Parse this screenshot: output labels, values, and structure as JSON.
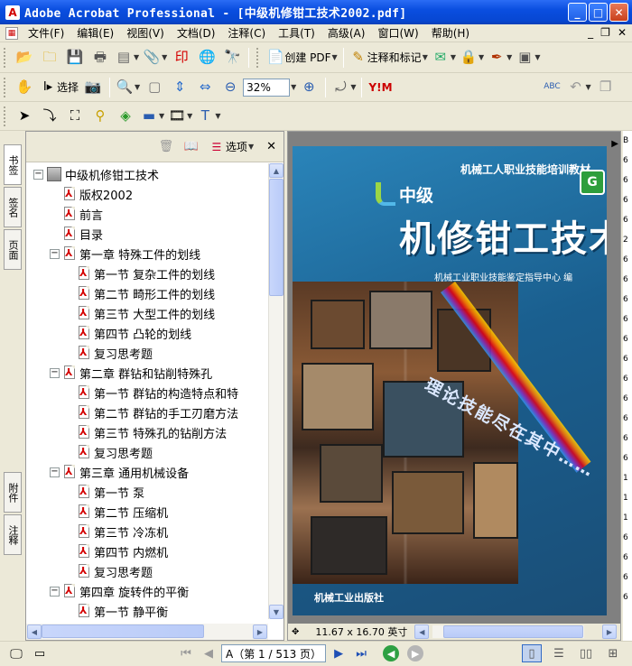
{
  "window": {
    "title": "Adobe Acrobat Professional - [中级机修钳工技术2002.pdf]",
    "app_icon": "acrobat-icon",
    "buttons": {
      "minimize": "_",
      "maximize": "□",
      "close": "✕"
    }
  },
  "menubar": {
    "items": [
      "文件(F)",
      "编辑(E)",
      "视图(V)",
      "文档(D)",
      "注释(C)",
      "工具(T)",
      "高级(A)",
      "窗口(W)",
      "帮助(H)"
    ],
    "mdi": {
      "minimize": "_",
      "restore": "❐",
      "close": "✕"
    }
  },
  "toolbar1": {
    "create_pdf": "创建 PDF",
    "comment_markup": "注释和标记"
  },
  "toolbar2": {
    "select_label": "选择",
    "zoom_value": "32%"
  },
  "panel": {
    "options_label": "选项",
    "close": "✕",
    "tabs": {
      "bookmarks": "书签",
      "signatures": "签名",
      "pages": "页面",
      "attachments": "附件",
      "comments": "注释"
    },
    "tree": [
      {
        "level": 0,
        "label": "中级机修钳工技术",
        "toggle": "−",
        "root": true
      },
      {
        "level": 1,
        "label": "版权2002"
      },
      {
        "level": 1,
        "label": "前言"
      },
      {
        "level": 1,
        "label": "目录"
      },
      {
        "level": 1,
        "label": "第一章  特殊工件的划线",
        "toggle": "−"
      },
      {
        "level": 2,
        "label": "第一节  复杂工件的划线"
      },
      {
        "level": 2,
        "label": "第二节  畸形工件的划线"
      },
      {
        "level": 2,
        "label": "第三节  大型工件的划线"
      },
      {
        "level": 2,
        "label": "第四节  凸轮的划线"
      },
      {
        "level": 2,
        "label": "复习思考题"
      },
      {
        "level": 1,
        "label": "第二章  群钻和钻削特殊孔",
        "toggle": "−"
      },
      {
        "level": 2,
        "label": "第一节  群钻的构造特点和特"
      },
      {
        "level": 2,
        "label": "第二节  群钻的手工刃磨方法"
      },
      {
        "level": 2,
        "label": "第三节  特殊孔的钻削方法"
      },
      {
        "level": 2,
        "label": "复习思考题"
      },
      {
        "level": 1,
        "label": "第三章  通用机械设备",
        "toggle": "−"
      },
      {
        "level": 2,
        "label": "第一节  泵"
      },
      {
        "level": 2,
        "label": "第二节  压缩机"
      },
      {
        "level": 2,
        "label": "第三节  冷冻机"
      },
      {
        "level": 2,
        "label": "第四节  内燃机"
      },
      {
        "level": 2,
        "label": "复习思考题"
      },
      {
        "level": 1,
        "label": "第四章  旋转件的平衡",
        "toggle": "−"
      },
      {
        "level": 2,
        "label": "第一节  静平衡"
      }
    ]
  },
  "document": {
    "cover": {
      "series": "机械工人职业技能培训教材",
      "level": "中级",
      "title": "机修钳工技术",
      "editor": "机械工业职业技能鉴定指导中心  编",
      "slogan": "理论技能尽在其中……",
      "publisher": "机械工业出版社",
      "badge": "G"
    },
    "page_size": "11.67 x 16.70 英寸"
  },
  "right_edge_digits": [
    "B",
    "6",
    "6",
    "6",
    "6",
    "2",
    "6",
    "6",
    "6",
    "6",
    "6",
    "6",
    "6",
    "6",
    "6",
    "6",
    "6",
    "1",
    "1",
    "1",
    "6",
    "6",
    "6",
    "6"
  ],
  "statusbar": {
    "page_display": "A（第 1 / 513 页）"
  }
}
